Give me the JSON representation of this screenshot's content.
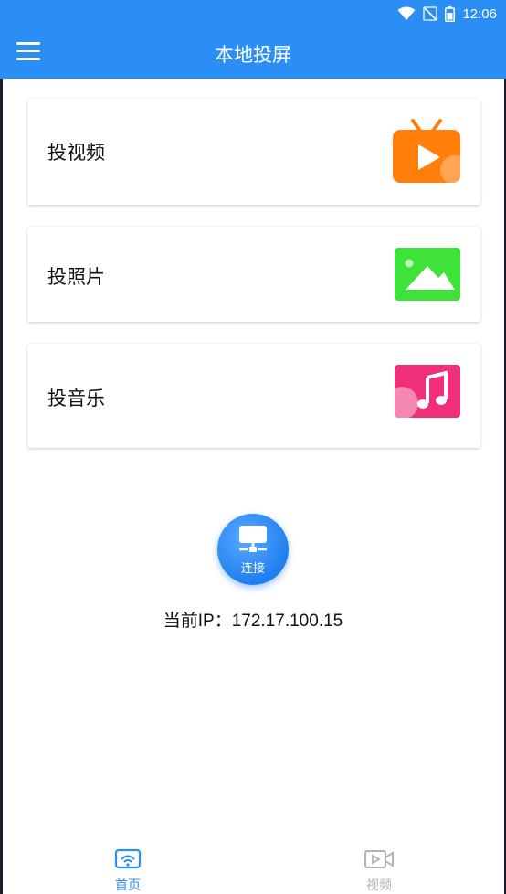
{
  "status": {
    "time": "12:06"
  },
  "header": {
    "title": "本地投屏",
    "menu_icon": "menu-icon"
  },
  "cards": [
    {
      "label": "投视频",
      "icon": "tv-video-icon",
      "color": "#ff7f0a"
    },
    {
      "label": "投照片",
      "icon": "image-icon",
      "color": "#3ee33a"
    },
    {
      "label": "投音乐",
      "icon": "music-note-icon",
      "color": "#ef2f7a"
    }
  ],
  "connect": {
    "label": "连接",
    "icon": "monitor-network-icon"
  },
  "ip": {
    "text": "当前IP：172.17.100.15"
  },
  "nav": [
    {
      "label": "首页",
      "icon": "wifi-tv-icon",
      "active": true,
      "color": "#2b8ef5"
    },
    {
      "label": "视频",
      "icon": "video-icon",
      "active": false,
      "color": "#b3b3b3"
    }
  ],
  "colors": {
    "primary": "#2b8ef5"
  }
}
